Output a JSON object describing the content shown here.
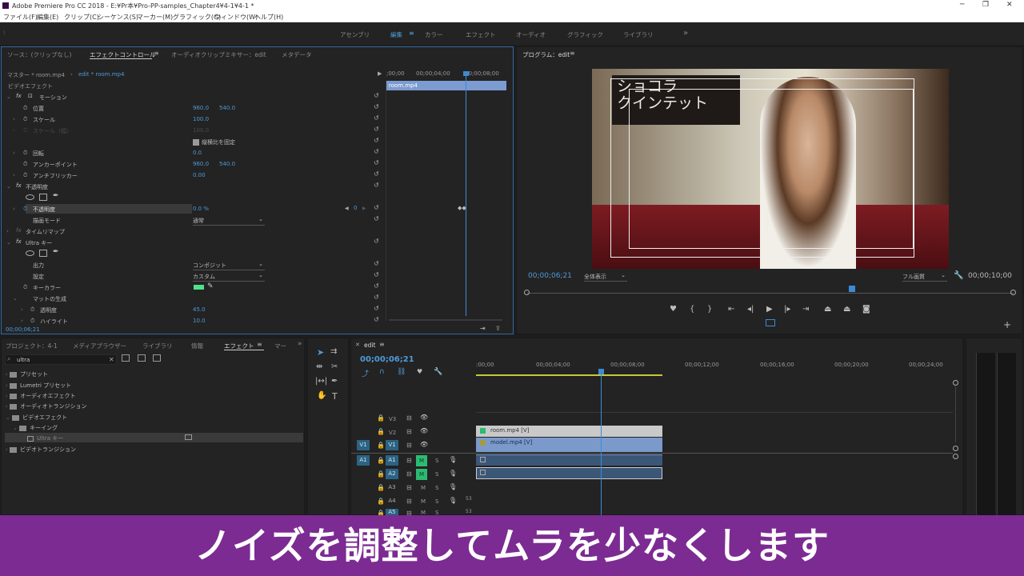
{
  "window": {
    "title": "Adobe Premiere Pro CC 2018 - E:¥Pr本¥Pro-PP-samples_Chapter4¥4-1¥4-1 *"
  },
  "menu": [
    "ファイル(F)",
    "編集(E)",
    "クリップ(C)",
    "シーケンス(S)",
    "マーカー(M)",
    "グラフィック(G)",
    "ウィンドウ(W)",
    "ヘルプ(H)"
  ],
  "workspaces": {
    "items": [
      "アセンブリ",
      "編集",
      "カラー",
      "エフェクト",
      "オーディオ",
      "グラフィック",
      "ライブラリ"
    ],
    "active": "編集",
    "more": "»"
  },
  "effect_controls": {
    "tabs": [
      "ソース：(クリップなし)",
      "エフェクトコントロール",
      "オーディオクリップミキサー：edit",
      "メタデータ"
    ],
    "master": "マスター * room.mp4",
    "clip": "edit * room.mp4",
    "ruler": [
      ";00;00",
      "00;00;04;00",
      "00;00;08;00"
    ],
    "clip_bar": "room.mp4",
    "section_video": "ビデオエフェクト",
    "motion": "モーション",
    "position_label": "位置",
    "position_x": "960.0",
    "position_y": "540.0",
    "scale_label": "スケール",
    "scale_value": "100.0",
    "scale_w_label": "スケール（幅）",
    "scale_w_value": "100.0",
    "uniform_scale": "縦横比を固定",
    "rotation_label": "回転",
    "rotation_value": "0.0",
    "anchor_label": "アンカーポイント",
    "anchor_x": "960.0",
    "anchor_y": "540.0",
    "antiflicker_label": "アンチフリッカー",
    "antiflicker_value": "0.00",
    "opacity_group": "不透明度",
    "opacity_label": "不透明度",
    "opacity_value": "0.0 %",
    "kf_index": "0",
    "blend_label": "描画モード",
    "blend_value": "通常",
    "time_remap": "タイムリマップ",
    "ultra_key": "Ultra キー",
    "output_label": "出力",
    "output_value": "コンポジット",
    "setting_label": "設定",
    "setting_value": "カスタム",
    "keycolor_label": "キーカラー",
    "matte_gen": "マットの生成",
    "transparency_label": "透明度",
    "transparency_value": "45.0",
    "highlight_label": "ハイライト",
    "highlight_value": "10.0",
    "timecode": "00;00;06;21"
  },
  "program": {
    "title": "プログラム：edit",
    "timecode": "00;00;06;21",
    "fit": "全体表示",
    "quality": "フル画質",
    "duration": "00;00;10;00",
    "sign_text_1": "ショコラ",
    "sign_text_2": "クインテット"
  },
  "project": {
    "tabs": [
      "プロジェクト：4-1",
      "メディアブラウザー",
      "ライブラリ",
      "情報",
      "エフェクト",
      "マー"
    ],
    "search_value": "ultra",
    "tree": [
      "プリセット",
      "Lumetri プリセット",
      "オーディオエフェクト",
      "オーディオトランジション",
      "ビデオエフェクト",
      "キーイング",
      "Ultra キー",
      "ビデオトランジション"
    ]
  },
  "timeline": {
    "tab": "edit",
    "timecode": "00;00;06;21",
    "ruler": [
      ":00;00",
      "00;00;04;00",
      "00;00;08;00",
      "00;00;12;00",
      "00;00;16;00",
      "00;00;20;00",
      "00;00;24;00"
    ],
    "video_tracks": [
      "V3",
      "V2",
      "V1"
    ],
    "audio_tracks": [
      "A1",
      "A2",
      "A3",
      "A4",
      "A5"
    ],
    "src_v": "V1",
    "src_a": "A1",
    "clip_room": "room.mp4 [V]",
    "clip_model": "model.mp4 [V]",
    "m_label": "M",
    "s_label": "S",
    "vol_a4": "53",
    "vol_a5": "53"
  },
  "caption": "ノイズを調整してムラを少なくします"
}
